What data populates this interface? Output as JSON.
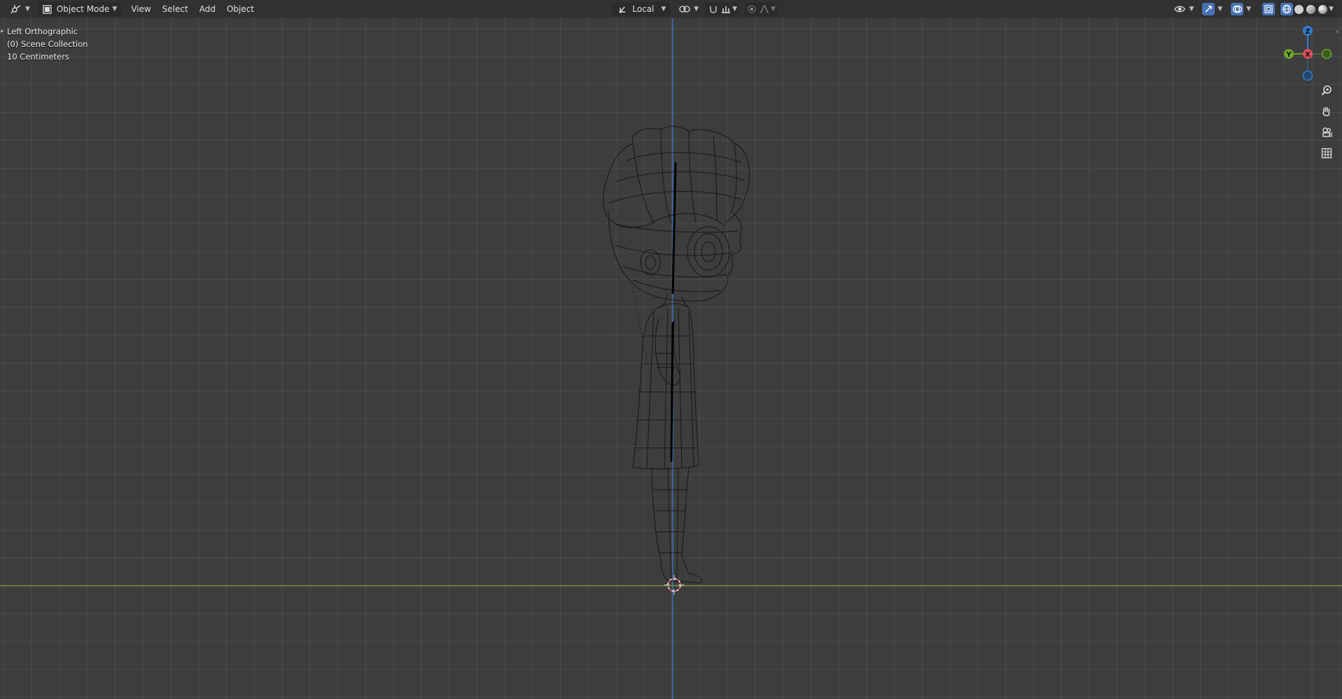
{
  "header": {
    "mode_label": "Object Mode",
    "menus": [
      "View",
      "Select",
      "Add",
      "Object"
    ],
    "transform_orientation": "Local"
  },
  "viewport_info": {
    "view_name": "Left Orthographic",
    "collection": "(0) Scene Collection",
    "scale": "10 Centimeters"
  },
  "gizmo": {
    "z_label": "Z",
    "y_label": "Y",
    "x_label": "X",
    "colors": {
      "z": "#2f7fd1",
      "y": "#6ea42a",
      "x": "#e04e5e"
    }
  },
  "colors": {
    "viewport_bg": "#3d3d3d",
    "header_bg": "#303030",
    "ground_axis": "#7aa02d",
    "vertical_axis": "#3c78c8",
    "active_button": "#4772b3"
  },
  "icons": {
    "editor_type": "view3d-icon",
    "mode": "object-mode-icon",
    "orientation": "orientation-local-icon",
    "pivot": "pivot-icon",
    "snap": "snap-magnet-icon",
    "snap_target": "snap-increment-icon",
    "proportional": "proportional-edit-icon",
    "falloff": "falloff-curve-icon",
    "visibility": "eye-visibility-icon",
    "gizmo_toggle": "gizmo-icon",
    "overlays": "overlays-icon",
    "xray": "xray-icon",
    "zoom": "zoom-icon",
    "pan": "hand-pan-icon",
    "camera": "camera-icon",
    "ortho_toggle": "grid-ortho-icon"
  }
}
